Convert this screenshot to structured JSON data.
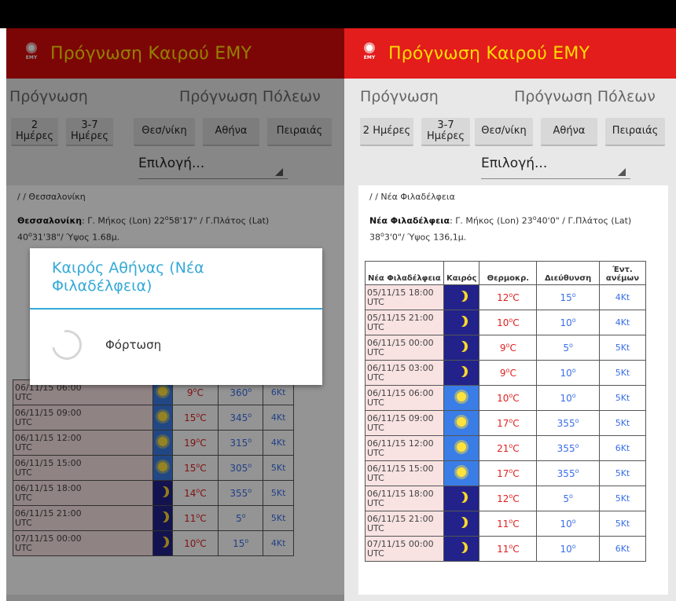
{
  "app": {
    "title": "Πρόγνωση Καιρού ΕΜΥ",
    "logo_text": "EMY"
  },
  "colors": {
    "header_red": "#e31c1c",
    "title_yellow": "#ffdd00",
    "dialog_blue": "#35a9d8",
    "temp_red": "#e02020",
    "dir_blue": "#3a6ee8"
  },
  "controls": {
    "forecast_label": "Πρόγνωση",
    "city_forecast_label": "Πρόγνωση Πόλεων",
    "btn_2days": "2 Ημέρες",
    "btn_3_7days_top": "3-7",
    "btn_3_7days_bottom": "Ημέρες",
    "btn_thessaloniki": "Θεσ/νίκη",
    "btn_athens": "Αθήνα",
    "btn_piraeus": "Πειραιάς",
    "select_value": "Επιλογή..."
  },
  "left": {
    "breadcrumb": "/ / Θεσσαλονίκη",
    "coords_city": "Θεσσαλονίκη",
    "coords_line1": ": Γ. Μήκος (Lon) 22",
    "coords_line1b": "58'17\" / Γ.Πλάτος (Lat)",
    "coords_line2": "40",
    "coords_line2b": "31'38\"/ Ύψος 1.68μ.",
    "rows": [
      {
        "date": "06/11/15 06:00",
        "tz": "UTC",
        "icon": "sun-icon",
        "day": true,
        "temp": "9",
        "dir": "360",
        "wind": "6Kt"
      },
      {
        "date": "06/11/15 09:00",
        "tz": "UTC",
        "icon": "sun-icon",
        "day": true,
        "temp": "15",
        "dir": "345",
        "wind": "4Kt"
      },
      {
        "date": "06/11/15 12:00",
        "tz": "UTC",
        "icon": "sun-icon",
        "day": true,
        "temp": "19",
        "dir": "315",
        "wind": "4Kt"
      },
      {
        "date": "06/11/15 15:00",
        "tz": "UTC",
        "icon": "sun-icon",
        "day": true,
        "temp": "15",
        "dir": "305",
        "wind": "5Kt"
      },
      {
        "date": "06/11/15 18:00",
        "tz": "UTC",
        "icon": "moon-icon",
        "day": false,
        "temp": "14",
        "dir": "355",
        "wind": "5Kt"
      },
      {
        "date": "06/11/15 21:00",
        "tz": "UTC",
        "icon": "moon-icon",
        "day": false,
        "temp": "11",
        "dir": "5",
        "wind": "5Kt"
      },
      {
        "date": "07/11/15 00:00",
        "tz": "UTC",
        "icon": "moon-icon",
        "day": false,
        "temp": "10",
        "dir": "15",
        "wind": "4Kt"
      }
    ]
  },
  "dialog": {
    "title": "Καιρός Αθήνας (Νέα Φιλαδέλφεια)",
    "message": "Φόρτωση"
  },
  "right": {
    "breadcrumb": "/ / Νέα Φιλαδέλφεια",
    "coords_city": "Νέα Φιλαδέλφεια",
    "coords_line1": ": Γ. Μήκος (Lon) 23",
    "coords_line1b": "40'0\" / Γ.Πλάτος (Lat)",
    "coords_line2": "38",
    "coords_line2b": "3'0\"/ Ύψος 136,1μ.",
    "headers": {
      "location": "Νέα Φιλαδέλφεια",
      "weather": "Καιρός",
      "temp": "Θερμοκρ.",
      "direction": "Διεύθυνση",
      "wind_top": "Έντ.",
      "wind_bottom": "ανέμων"
    },
    "rows": [
      {
        "date": "05/11/15 18:00",
        "tz": "UTC",
        "icon": "moon-icon",
        "day": false,
        "temp": "12",
        "dir": "15",
        "wind": "4Kt"
      },
      {
        "date": "05/11/15 21:00",
        "tz": "UTC",
        "icon": "moon-icon",
        "day": false,
        "temp": "10",
        "dir": "10",
        "wind": "4Kt"
      },
      {
        "date": "06/11/15 00:00",
        "tz": "UTC",
        "icon": "moon-icon",
        "day": false,
        "temp": "9",
        "dir": "5",
        "wind": "5Kt"
      },
      {
        "date": "06/11/15 03:00",
        "tz": "UTC",
        "icon": "moon-icon",
        "day": false,
        "temp": "9",
        "dir": "10",
        "wind": "5Kt"
      },
      {
        "date": "06/11/15 06:00",
        "tz": "UTC",
        "icon": "sun-icon",
        "day": true,
        "temp": "10",
        "dir": "10",
        "wind": "5Kt"
      },
      {
        "date": "06/11/15 09:00",
        "tz": "UTC",
        "icon": "sun-icon",
        "day": true,
        "temp": "17",
        "dir": "355",
        "wind": "5Kt"
      },
      {
        "date": "06/11/15 12:00",
        "tz": "UTC",
        "icon": "sun-icon",
        "day": true,
        "temp": "21",
        "dir": "355",
        "wind": "6Kt"
      },
      {
        "date": "06/11/15 15:00",
        "tz": "UTC",
        "icon": "sun-icon",
        "day": true,
        "temp": "17",
        "dir": "355",
        "wind": "5Kt"
      },
      {
        "date": "06/11/15 18:00",
        "tz": "UTC",
        "icon": "moon-icon",
        "day": false,
        "temp": "12",
        "dir": "5",
        "wind": "5Kt"
      },
      {
        "date": "06/11/15 21:00",
        "tz": "UTC",
        "icon": "moon-icon",
        "day": false,
        "temp": "11",
        "dir": "10",
        "wind": "5Kt"
      },
      {
        "date": "07/11/15 00:00",
        "tz": "UTC",
        "icon": "moon-icon",
        "day": false,
        "temp": "11",
        "dir": "10",
        "wind": "6Kt"
      }
    ]
  },
  "units": {
    "degree": "o",
    "celsius": "C"
  }
}
